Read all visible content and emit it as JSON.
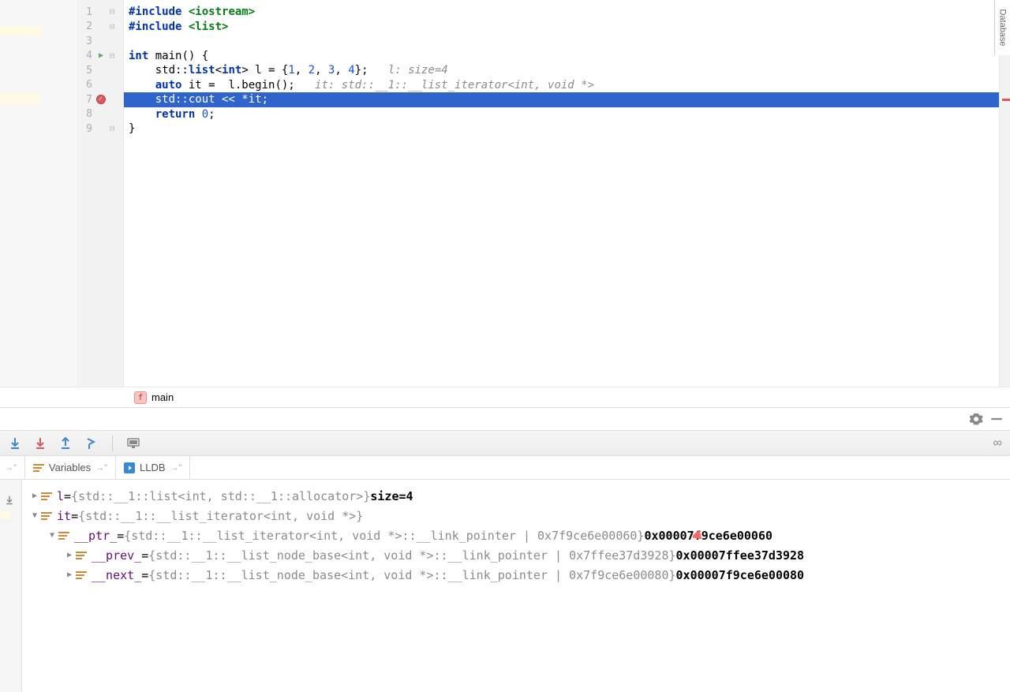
{
  "sidebar": {
    "database_label": "Database"
  },
  "editor": {
    "lines": [
      "1",
      "2",
      "3",
      "4",
      "5",
      "6",
      "7",
      "8",
      "9"
    ],
    "code": {
      "l1_a": "#include",
      "l1_b": " <iostream>",
      "l2_a": "#include",
      "l2_b": " <list>",
      "l3": "",
      "l4_a": "int",
      "l4_b": " main() {",
      "l5_a": "    std::",
      "l5_kw": "list",
      "l5_b": "<",
      "l5_kw2": "int",
      "l5_c": "> l = {",
      "l5_n1": "1",
      "l5_s1": ", ",
      "l5_n2": "2",
      "l5_s2": ", ",
      "l5_n3": "3",
      "l5_s3": ", ",
      "l5_n4": "4",
      "l5_d": "};   ",
      "l5_cm": "l: size=4",
      "l6_a": "    ",
      "l6_kw": "auto",
      "l6_b": " it =  l.begin();   ",
      "l6_cm": "it: std::__1::__list_iterator<int, void *>",
      "l7": "    std::cout << *it;",
      "l8_a": "    ",
      "l8_kw": "return",
      "l8_b": " ",
      "l8_n": "0",
      "l8_c": ";",
      "l9": "}"
    }
  },
  "breadcrumb": {
    "icon_letter": "f",
    "label": "main"
  },
  "debugger": {
    "tabs": {
      "variables": "Variables",
      "lldb": "LLDB"
    },
    "vars": {
      "r1_name": "l",
      "r1_eq": " = ",
      "r1_type": "{std::__1::list<int, std::__1::allocator>} ",
      "r1_val": "size=4",
      "r2_name": "it",
      "r2_eq": " = ",
      "r2_type": "{std::__1::__list_iterator<int, void *>}",
      "r3_name": "__ptr_",
      "r3_eq": " = ",
      "r3_type": "{std::__1::__list_iterator<int, void *>::__link_pointer | 0x7f9ce6e00060} ",
      "r3_val": "0x00007f9ce6e00060",
      "r4_name": "__prev_",
      "r4_eq": " = ",
      "r4_type": "{std::__1::__list_node_base<int, void *>::__link_pointer | 0x7ffee37d3928} ",
      "r4_val": "0x00007ffee37d3928",
      "r5_name": "__next_",
      "r5_eq": " = ",
      "r5_type": "{std::__1::__list_node_base<int, void *>::__link_pointer | 0x7f9ce6e00080} ",
      "r5_val": "0x00007f9ce6e00080"
    }
  }
}
